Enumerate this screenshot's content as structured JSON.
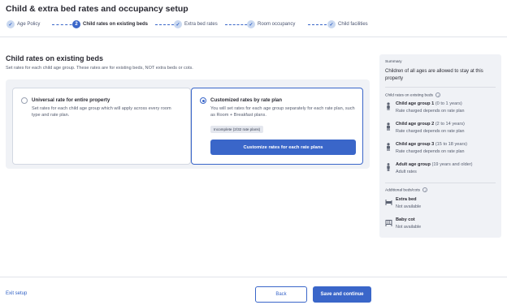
{
  "page": {
    "title": "Child & extra bed rates and occupancy setup"
  },
  "stepper": {
    "steps": [
      {
        "label": "Age Policy",
        "state": "done"
      },
      {
        "label": "Child rates on existing beds",
        "state": "active",
        "number": "2"
      },
      {
        "label": "Extra bed rates",
        "state": "done"
      },
      {
        "label": "Room occupancy",
        "state": "done"
      },
      {
        "label": "Child facilities",
        "state": "done"
      }
    ],
    "accent": "#3a66c9"
  },
  "section": {
    "title": "Child rates on existing beds",
    "description": "Set rates for each child age group. These rates are for existing beds, NOT extra beds or cots."
  },
  "options": {
    "universal": {
      "title": "Universal rate for entire property",
      "description": "Set rates for each child age group which will apply across every room type and rate plan.",
      "selected": false
    },
    "customized": {
      "title": "Customized rates by rate plan",
      "description": "You will set rates for each age group separately for each rate plan, such as Room + Breakfast plans.",
      "badge": "Incomplete (2/32 rate plans)",
      "button": "Customize rates for each rate plans",
      "selected": true
    }
  },
  "summary": {
    "heading": "Summary",
    "statement": "Children of all ages are allowed to stay at this property",
    "child_rates_heading": "Child rates on existing beds",
    "groups": [
      {
        "name": "Child age group 1",
        "range": "(0 to 1 years)",
        "detail": "Rate charged depends on rate plan",
        "icon": "child-small-icon"
      },
      {
        "name": "Child age group 2",
        "range": "(2 to 14 years)",
        "detail": "Rate charged depends on rate plan",
        "icon": "child-icon"
      },
      {
        "name": "Child age group 3",
        "range": "(15 to 18 years)",
        "detail": "Rate charged depends on rate plan",
        "icon": "child-icon"
      },
      {
        "name": "Adult age group",
        "range": "(19 years and older)",
        "detail": "Adult rates",
        "icon": "adult-icon"
      }
    ],
    "beds_heading": "Additional beds/cots",
    "beds": [
      {
        "name": "Extra bed",
        "detail": "Not available",
        "icon": "bed-icon"
      },
      {
        "name": "Baby cot",
        "detail": "Not available",
        "icon": "crib-icon"
      }
    ]
  },
  "footer": {
    "exit": "Exit setup",
    "back": "Back",
    "save": "Save and continue"
  }
}
